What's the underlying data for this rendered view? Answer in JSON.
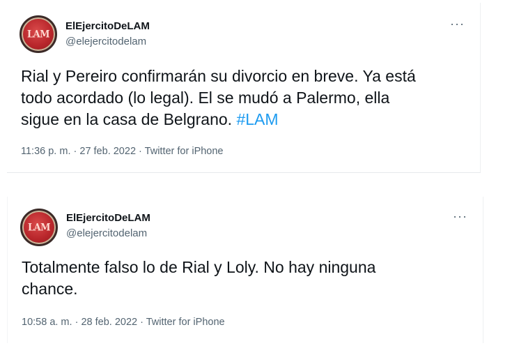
{
  "tweets": [
    {
      "avatar_text": "LAM",
      "display_name": "ElEjercitoDeLAM",
      "handle": "@elejercitodelam",
      "more_icon": "···",
      "text": "Rial y Pereiro confirmarán su divorcio en breve. Ya está\ntodo acordado (lo legal). El se mudó a Palermo, ella\nsigue en la casa de Belgrano. ",
      "hashtag": "#LAM",
      "time": "11:36 p. m.",
      "date": "27 feb. 2022",
      "separator": "·",
      "source": "Twitter for iPhone"
    },
    {
      "avatar_text": "LAM",
      "display_name": "ElEjercitoDeLAM",
      "handle": "@elejercitodelam",
      "more_icon": "···",
      "text": "Totalmente falso lo de Rial y Loly. No hay ninguna\nchance.",
      "time": "10:58 a. m.",
      "date": "28 feb. 2022",
      "separator": "·",
      "source": "Twitter for iPhone"
    }
  ],
  "colors": {
    "text": "#0f1419",
    "secondary": "#536471",
    "link": "#1d9bf0",
    "avatar_red": "#b8262b"
  },
  "icons": {
    "more": "more-horizontal-icon",
    "avatar": "lam-logo-avatar"
  }
}
